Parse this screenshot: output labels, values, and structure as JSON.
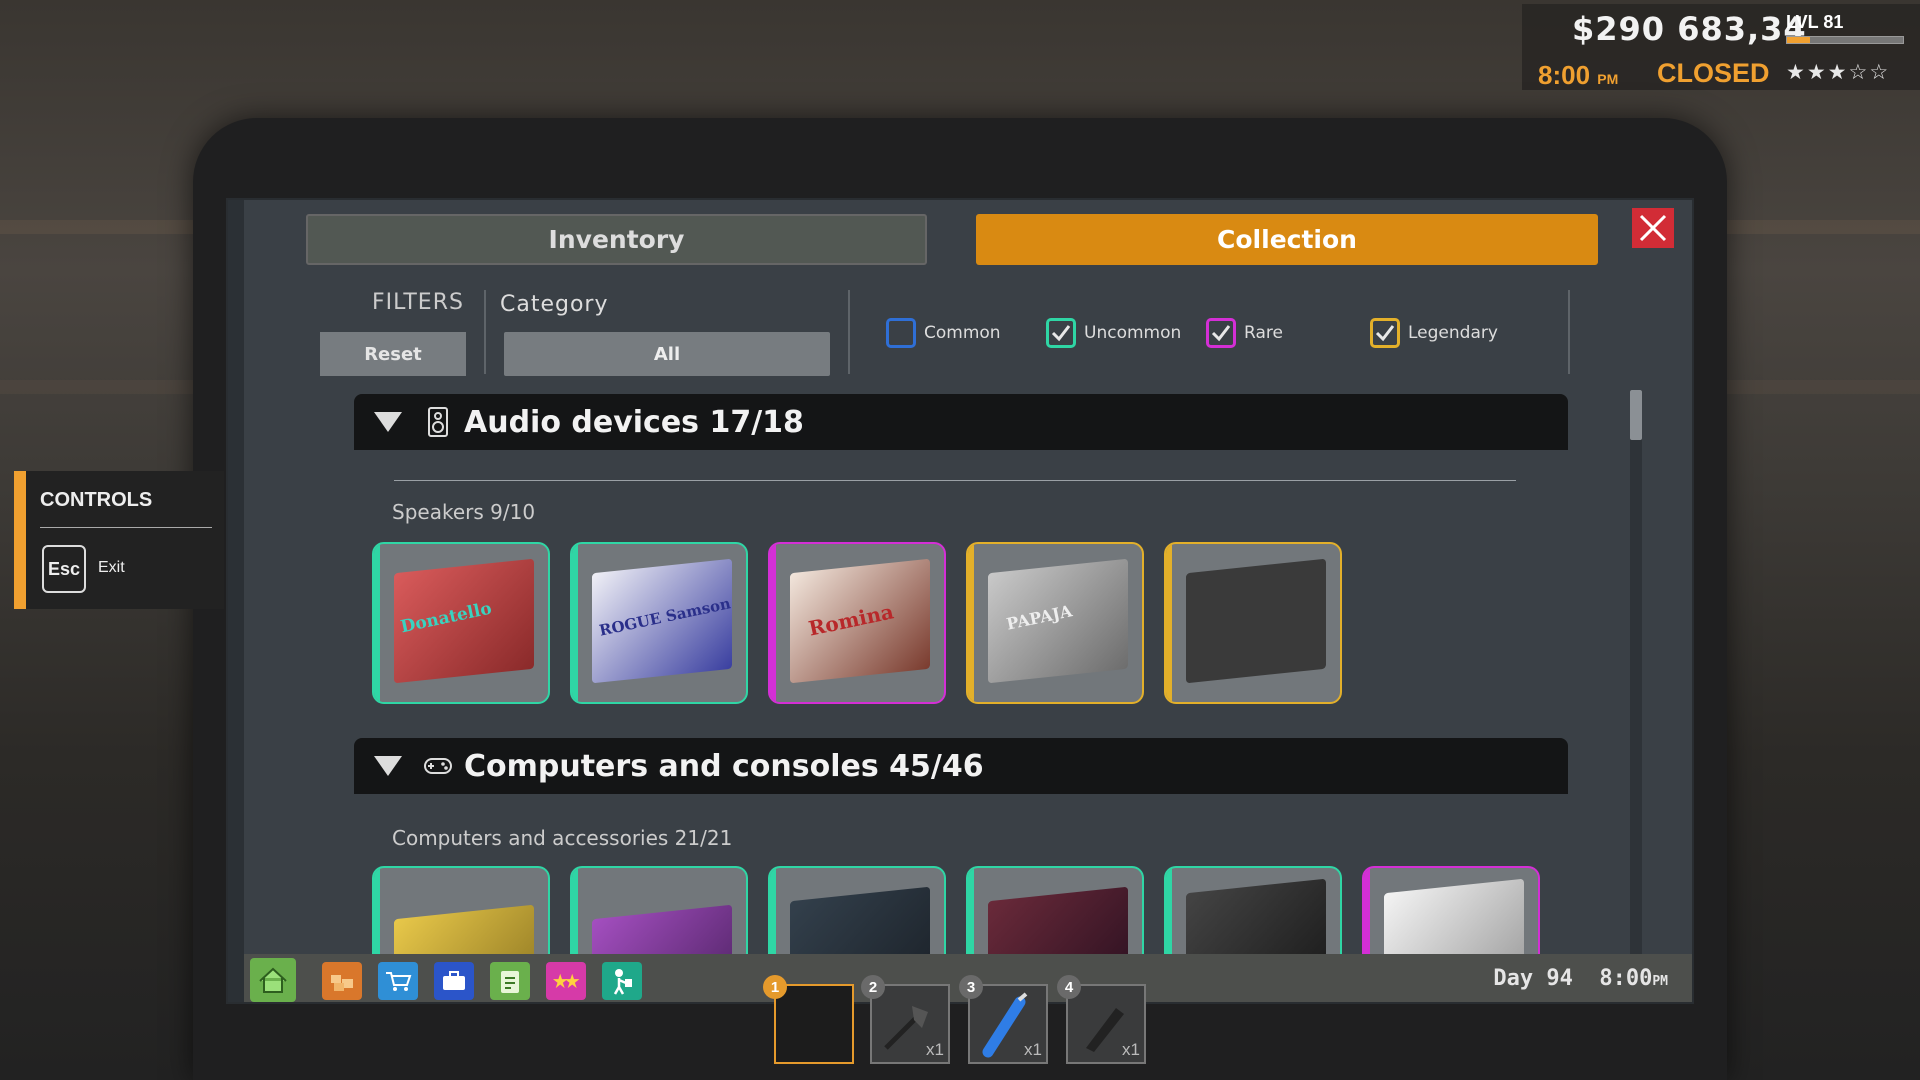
{
  "hud": {
    "money": "$290 683,34",
    "level": "LVL 81",
    "xp_fraction": 0.2,
    "time": "8:00",
    "time_suffix": "PM",
    "store_status": "CLOSED",
    "rating_stars": 3,
    "rating_max": 5
  },
  "tabs": {
    "inventory": "Inventory",
    "collection": "Collection",
    "active": "collection"
  },
  "filters": {
    "label": "FILTERS",
    "reset": "Reset",
    "category_label": "Category",
    "category_value": "All",
    "rarities": [
      {
        "label": "Common",
        "checked": false,
        "color": "#2f6fd6"
      },
      {
        "label": "Uncommon",
        "checked": true,
        "color": "#2fd6a5"
      },
      {
        "label": "Rare",
        "checked": true,
        "color": "#d42fd6"
      },
      {
        "label": "Legendary",
        "checked": true,
        "color": "#e3b02a"
      }
    ]
  },
  "sections": [
    {
      "title": "Audio devices 17/18",
      "icon": "speaker-icon",
      "subsections": [
        {
          "label": "Speakers 9/10",
          "items": [
            {
              "name": "Donatello",
              "rarity": "uncommon",
              "color": "#2fd6a5"
            },
            {
              "name": "ROGUE Samson",
              "rarity": "uncommon",
              "color": "#2fd6a5"
            },
            {
              "name": "Romina",
              "rarity": "rare",
              "color": "#d42fd6"
            },
            {
              "name": "PAPAJA",
              "rarity": "legendary",
              "color": "#e3b02a"
            },
            {
              "name": "",
              "rarity": "legendary",
              "color": "#e3b02a",
              "locked": true
            }
          ]
        }
      ]
    },
    {
      "title": "Computers and consoles 45/46",
      "icon": "gamepad-icon",
      "subsections": [
        {
          "label": "Computers and accessories 21/21",
          "items": [
            {
              "rarity": "uncommon",
              "color": "#2fd6a5"
            },
            {
              "rarity": "uncommon",
              "color": "#2fd6a5"
            },
            {
              "rarity": "uncommon",
              "color": "#2fd6a5"
            },
            {
              "rarity": "uncommon",
              "color": "#2fd6a5"
            },
            {
              "rarity": "uncommon",
              "color": "#2fd6a5"
            },
            {
              "rarity": "rare",
              "color": "#d42fd6"
            }
          ]
        }
      ]
    }
  ],
  "taskbar": {
    "icons": [
      "home-icon",
      "boxes-icon",
      "cart-icon",
      "briefcase-icon",
      "clipboard-icon",
      "stars-icon",
      "worker-icon"
    ],
    "active_index": 4,
    "day": "Day 94",
    "time": "8:00",
    "time_suffix": "PM"
  },
  "controls": {
    "title": "CONTROLS",
    "key": "Esc",
    "action": "Exit"
  },
  "hotbar": [
    {
      "num": "1",
      "qty": "",
      "icon": "",
      "active": true
    },
    {
      "num": "2",
      "qty": "x1",
      "icon": "hatchet-icon"
    },
    {
      "num": "3",
      "qty": "x1",
      "icon": "box-cutter-icon"
    },
    {
      "num": "4",
      "qty": "x1",
      "icon": "scraper-icon"
    }
  ]
}
